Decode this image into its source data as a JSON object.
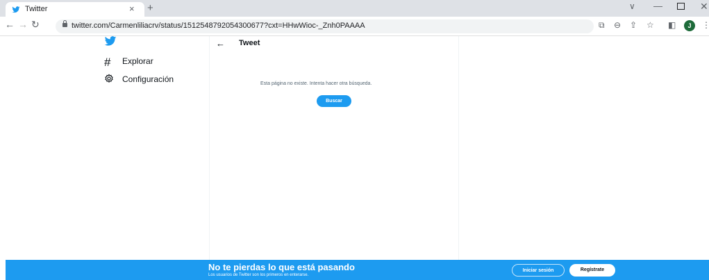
{
  "browser": {
    "tab_title": "Twitter",
    "tab_close": "×",
    "new_tab": "+",
    "url": "twitter.com/Carmenliliacrv/status/1512548792054300677?cxt=HHwWioc-_Znh0PAAAA",
    "profile_initial": "J",
    "icons": [
      "back-arrow-icon",
      "forward-arrow-icon",
      "reload-icon",
      "lock-icon",
      "install-icon",
      "zoom-icon",
      "share-icon",
      "bookmark-star-icon",
      "side-panel-icon"
    ],
    "window": {
      "chevron": "∨",
      "minimize": "—",
      "close": "✕"
    }
  },
  "sidebar": {
    "items": [
      {
        "label": "Explorar",
        "icon": "hashtag-icon"
      },
      {
        "label": "Configuración",
        "icon": "gear-icon"
      }
    ]
  },
  "main": {
    "back": "←",
    "header_title": "Tweet",
    "empty_message": "Esta página no existe. Intenta hacer otra búsqueda.",
    "search_button": "Buscar"
  },
  "banner": {
    "title": "No te pierdas lo que está pasando",
    "subtitle": "Los usuarios de Twitter son los primeros en enterarse.",
    "login": "Iniciar sesión",
    "signup": "Regístrate"
  },
  "colors": {
    "brand": "#1d9bf0",
    "text": "#0f1419",
    "secondary": "#536471"
  }
}
